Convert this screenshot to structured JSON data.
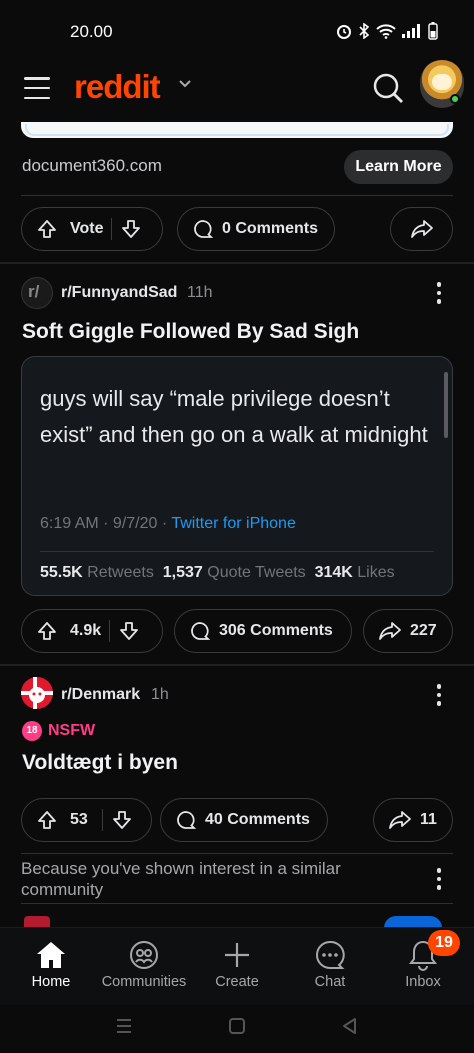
{
  "status_bar": {
    "time": "20.00"
  },
  "app": {
    "logo": "reddit"
  },
  "ad": {
    "domain": "document360.com",
    "cta": "Learn More",
    "vote_label": "Vote",
    "comments_label": "0 Comments"
  },
  "post1": {
    "subreddit": "r/FunnyandSad",
    "age": "11h",
    "title": "Soft Giggle Followed By Sad Sigh",
    "tweet": {
      "text": "guys will say “male privilege doesn’t exist” and then go on a walk at midnight",
      "time": "6:19 AM · 9/7/20 · ",
      "source": "Twitter for iPhone",
      "retweets_count": "55.5K",
      "retweets_label": "Retweets",
      "quotes_count": "1,537",
      "quotes_label": "Quote Tweets",
      "likes_count": "314K",
      "likes_label": "Likes"
    },
    "votes": "4.9k",
    "comments": "306 Comments",
    "shares": "227"
  },
  "post2": {
    "subreddit": "r/Denmark",
    "age": "1h",
    "nsfw_label": "NSFW",
    "nsfw_badge": "18",
    "title": "Voldtægt i byen",
    "votes": "53",
    "comments": "40 Comments",
    "shares": "11"
  },
  "recommendation": "Because you've shown interest in a similar community",
  "bottom_nav": {
    "items": [
      {
        "label": "Home",
        "icon": "home-icon"
      },
      {
        "label": "Communities",
        "icon": "communities-icon"
      },
      {
        "label": "Create",
        "icon": "plus-icon"
      },
      {
        "label": "Chat",
        "icon": "chat-icon"
      },
      {
        "label": "Inbox",
        "icon": "bell-icon"
      }
    ],
    "inbox_badge": "19"
  },
  "colors": {
    "brand": "#ff4500",
    "nsfw": "#ff3d86",
    "twitter_link": "#1d9bf0"
  }
}
